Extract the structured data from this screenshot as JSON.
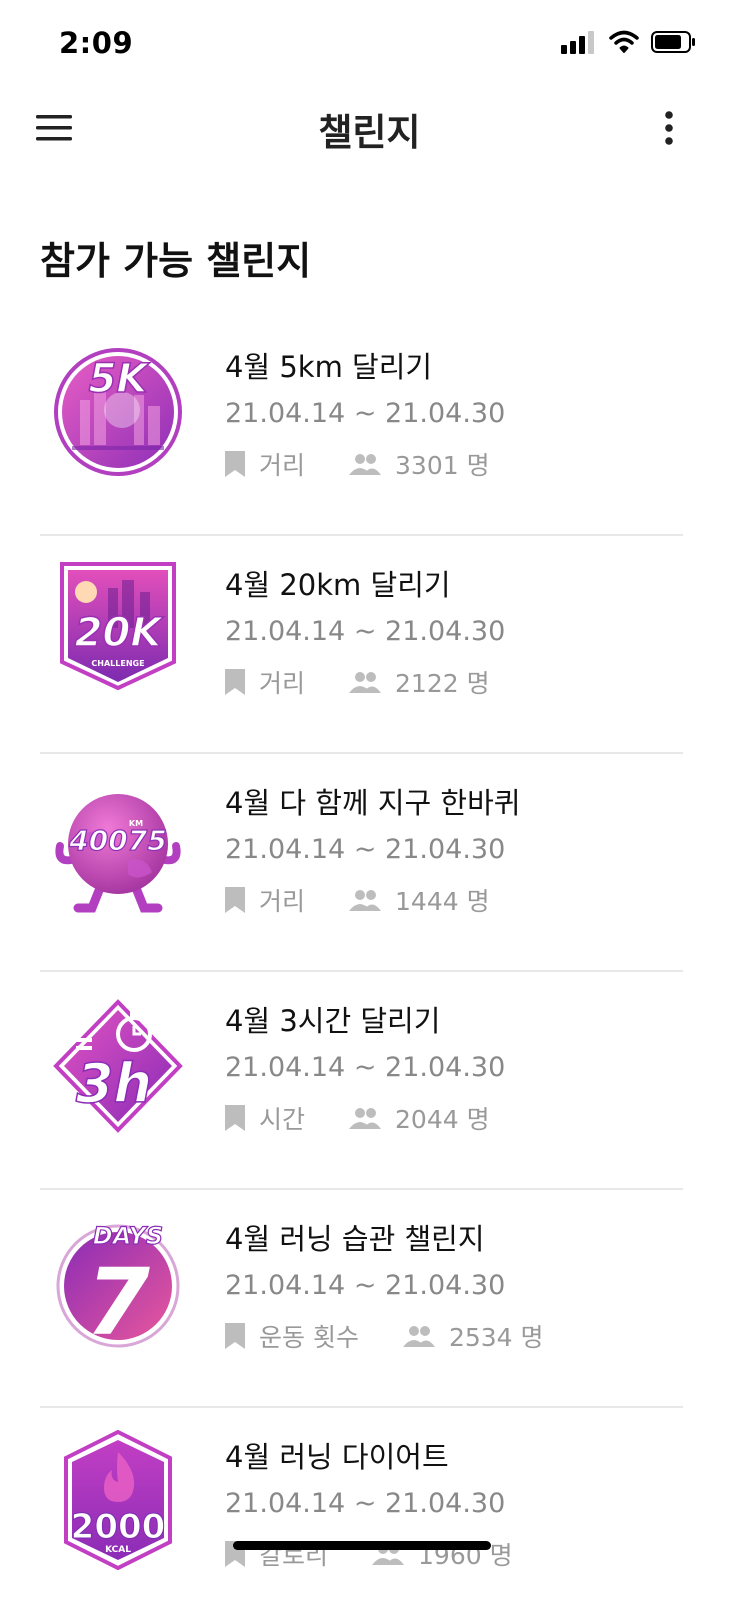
{
  "status_bar": {
    "time": "2:09"
  },
  "app_bar": {
    "title": "챌린지"
  },
  "section": {
    "title": "참가 가능 챌린지"
  },
  "challenges": [
    {
      "badge": "5K",
      "title": "4월 5km 달리기",
      "date": "21.04.14 ~ 21.04.30",
      "type": "거리",
      "participants": "3301 명"
    },
    {
      "badge": "20K",
      "title": "4월 20km 달리기",
      "date": "21.04.14 ~ 21.04.30",
      "type": "거리",
      "participants": "2122 명"
    },
    {
      "badge": "40075 KM",
      "title": "4월 다 함께 지구 한바퀴",
      "date": "21.04.14 ~ 21.04.30",
      "type": "거리",
      "participants": "1444 명"
    },
    {
      "badge": "3h",
      "title": "4월 3시간 달리기",
      "date": "21.04.14 ~ 21.04.30",
      "type": "시간",
      "participants": "2044 명"
    },
    {
      "badge": "DAYS 7",
      "title": "4월 러닝 습관 챌린지",
      "date": "21.04.14 ~ 21.04.30",
      "type": "운동 횟수",
      "participants": "2534 명"
    },
    {
      "badge": "2000 KCAL",
      "title": "4월 러닝 다이어트",
      "date": "21.04.14 ~ 21.04.30",
      "type": "칼로리",
      "participants": "1960 명"
    }
  ],
  "colors": {
    "accent": "#c23fc4",
    "accent_dark": "#9b2fb3",
    "divider": "#e8e8e8",
    "secondary_text": "#888888"
  }
}
